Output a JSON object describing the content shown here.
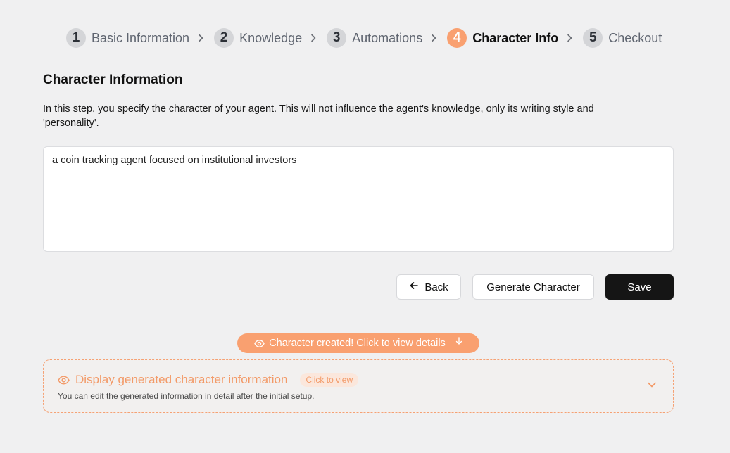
{
  "stepper": {
    "steps": [
      {
        "num": "1",
        "label": "Basic Information"
      },
      {
        "num": "2",
        "label": "Knowledge"
      },
      {
        "num": "3",
        "label": "Automations"
      },
      {
        "num": "4",
        "label": "Character Info"
      },
      {
        "num": "5",
        "label": "Checkout"
      }
    ],
    "active_index": 3
  },
  "section": {
    "title": "Character Information",
    "description": "In this step, you specify the character of your agent. This will not influence the agent's knowledge, only its writing style and 'personality'."
  },
  "character_input": {
    "value": "a coin tracking agent focused on institutional investors"
  },
  "actions": {
    "back_label": "Back",
    "back_icon": "arrow-left-icon",
    "generate_label": "Generate Character",
    "save_label": "Save"
  },
  "notice": {
    "label": "Character created! Click to view details",
    "icon": "eye-icon",
    "trailing_icon": "arrow-down-icon"
  },
  "generated_panel": {
    "title": "Display generated character information",
    "badge": "Click to view",
    "subtitle": "You can edit the generated information in detail after the initial setup.",
    "icon": "eye-icon",
    "toggle_icon": "chevron-down-icon"
  },
  "colors": {
    "accent": "#f9a070",
    "accent_text": "#f39a68",
    "background": "#f0f0f1",
    "primary_button": "#151515"
  }
}
